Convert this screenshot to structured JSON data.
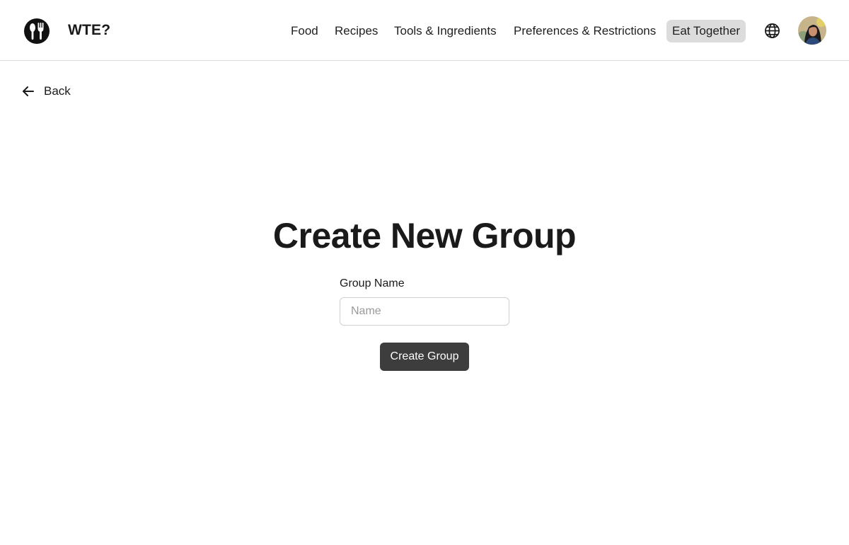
{
  "app": {
    "brand": "WTE?"
  },
  "nav": {
    "items": [
      {
        "label": "Food",
        "active": false
      },
      {
        "label": "Recipes",
        "active": false
      },
      {
        "label": "Tools & Ingredients",
        "active": false
      },
      {
        "label": "Preferences & Restrictions",
        "active": false
      },
      {
        "label": "Eat Together",
        "active": true
      }
    ]
  },
  "icons": {
    "logo": "fork-spoon-logo-icon",
    "language": "globe-icon",
    "back": "arrow-left-icon",
    "avatar": "user-avatar"
  },
  "back": {
    "label": "Back"
  },
  "main": {
    "title": "Create New Group",
    "group_name_label": "Group Name",
    "group_name_value": "",
    "group_name_placeholder": "Name",
    "submit_label": "Create Group"
  },
  "colors": {
    "primary_button": "#3d3d3d",
    "active_nav_bg": "#dcdcdc",
    "text": "#1a1a1a",
    "border": "#dcdcdc"
  }
}
